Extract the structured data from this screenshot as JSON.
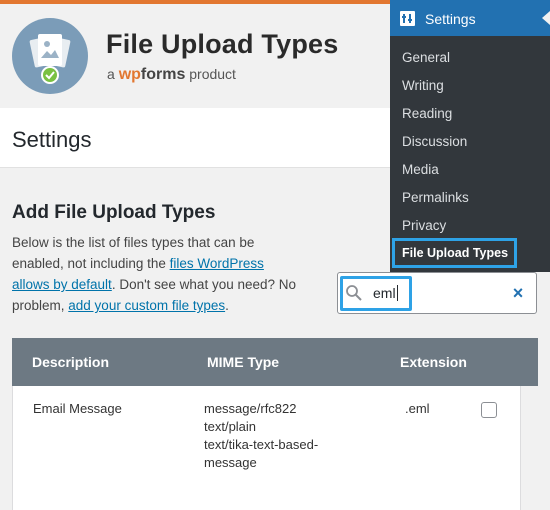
{
  "plugin": {
    "title": "File Upload Types",
    "by_prefix": "a",
    "brand_wp": "wp",
    "brand_forms": "forms",
    "by_suffix": "product"
  },
  "page": {
    "title": "Settings"
  },
  "section": {
    "title": "Add File Upload Types",
    "desc_1": "Below is the list of files types that can be enabled, not including the ",
    "link_defaults": "files WordPress allows by default",
    "desc_2": ". Don't see what you need? No problem, ",
    "link_custom": "add your custom file types",
    "desc_3": "."
  },
  "search": {
    "value": "eml",
    "clear_glyph": "×"
  },
  "table": {
    "headers": {
      "description": "Description",
      "mime": "MIME Type",
      "extension": "Extension"
    },
    "rows": [
      {
        "description": "Email Message",
        "mime": [
          "message/rfc822",
          "text/plain",
          "text/tika-text-based-",
          "message"
        ],
        "extension": ".eml",
        "checked": false
      }
    ]
  },
  "admin_menu": {
    "header": "Settings",
    "items": [
      "General",
      "Writing",
      "Reading",
      "Discussion",
      "Media",
      "Permalinks",
      "Privacy"
    ],
    "active": "File Upload Types"
  },
  "colors": {
    "accent": "#2271b1",
    "highlight": "#2ea2e6",
    "brand_orange": "#e27730",
    "table_header": "#6d7983",
    "menu_bg": "#32373c"
  }
}
